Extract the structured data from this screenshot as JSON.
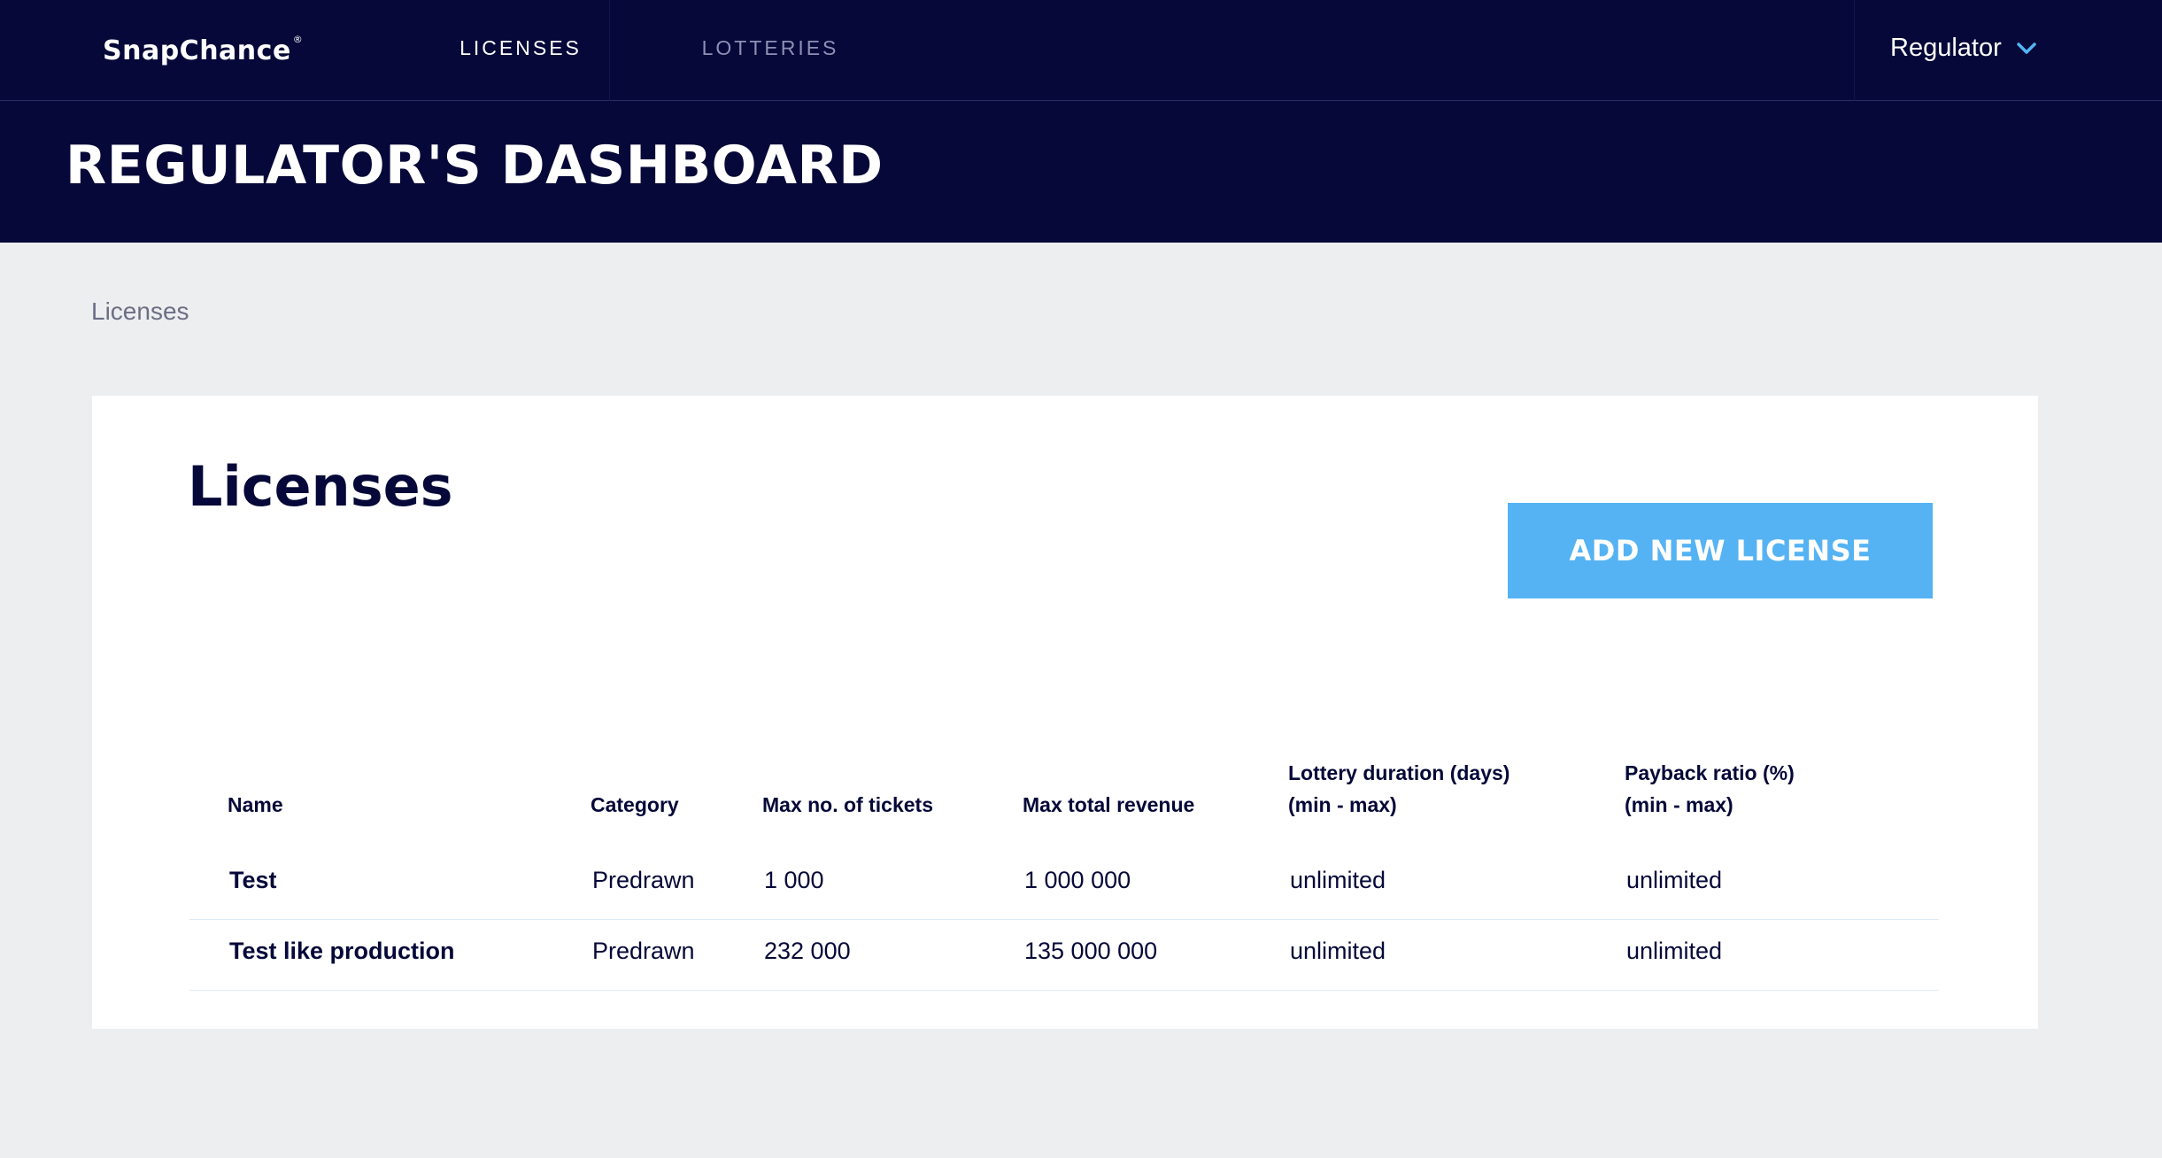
{
  "header": {
    "logo_text": "SnapChance",
    "logo_mark": "®",
    "nav": [
      {
        "label": "LICENSES",
        "active": true
      },
      {
        "label": "LOTTERIES",
        "active": false
      }
    ],
    "user": {
      "label": "Regulator",
      "icon": "chevron-down-icon"
    }
  },
  "hero": {
    "title": "REGULATOR'S DASHBOARD"
  },
  "breadcrumb": {
    "current": "Licenses"
  },
  "main": {
    "title": "Licenses",
    "add_button_label": "ADD NEW LICENSE",
    "table": {
      "headers": {
        "name": "Name",
        "category": "Category",
        "max_tickets": "Max no. of tickets",
        "max_revenue": "Max total revenue",
        "duration_line1": "Lottery duration (days)",
        "duration_line2": "(min - max)",
        "payback_line1": "Payback ratio (%)",
        "payback_line2": "(min - max)"
      },
      "rows": [
        {
          "name": "Test",
          "category": "Predrawn",
          "max_tickets": "1 000",
          "max_revenue": "1 000 000",
          "duration": "unlimited",
          "payback": "unlimited"
        },
        {
          "name": "Test like production",
          "category": "Predrawn",
          "max_tickets": "232 000",
          "max_revenue": "135 000 000",
          "duration": "unlimited",
          "payback": "unlimited"
        }
      ]
    }
  },
  "colors": {
    "navy": "#050838",
    "accent": "#55b3f3",
    "background": "#edeef0",
    "muted_nav": "#8c90b4"
  }
}
